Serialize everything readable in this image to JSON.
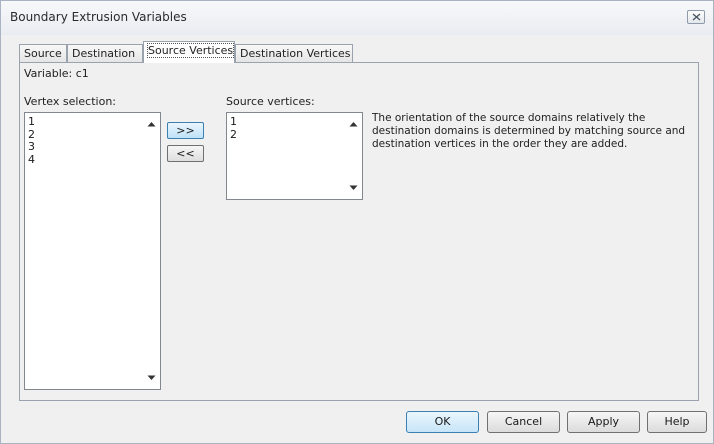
{
  "window": {
    "title": "Boundary Extrusion Variables"
  },
  "tabs": [
    {
      "label": "Source"
    },
    {
      "label": "Destination"
    },
    {
      "label": "Source Vertices"
    },
    {
      "label": "Destination Vertices"
    }
  ],
  "active_tab": "Source Vertices",
  "variable_label": "Variable: c1",
  "vertex_selection": {
    "label": "Vertex selection:",
    "items": [
      "1",
      "2",
      "3",
      "4"
    ]
  },
  "move": {
    "add_label": ">>",
    "remove_label": "<<"
  },
  "source_vertices": {
    "label": "Source vertices:",
    "items": [
      "1",
      "2"
    ]
  },
  "description": "The orientation of the source domains relatively the destination domains is determined by matching source and destination vertices in the order they are added.",
  "footer": {
    "ok_label": "OK",
    "cancel_label": "Cancel",
    "apply_label": "Apply",
    "help_label": "Help"
  }
}
